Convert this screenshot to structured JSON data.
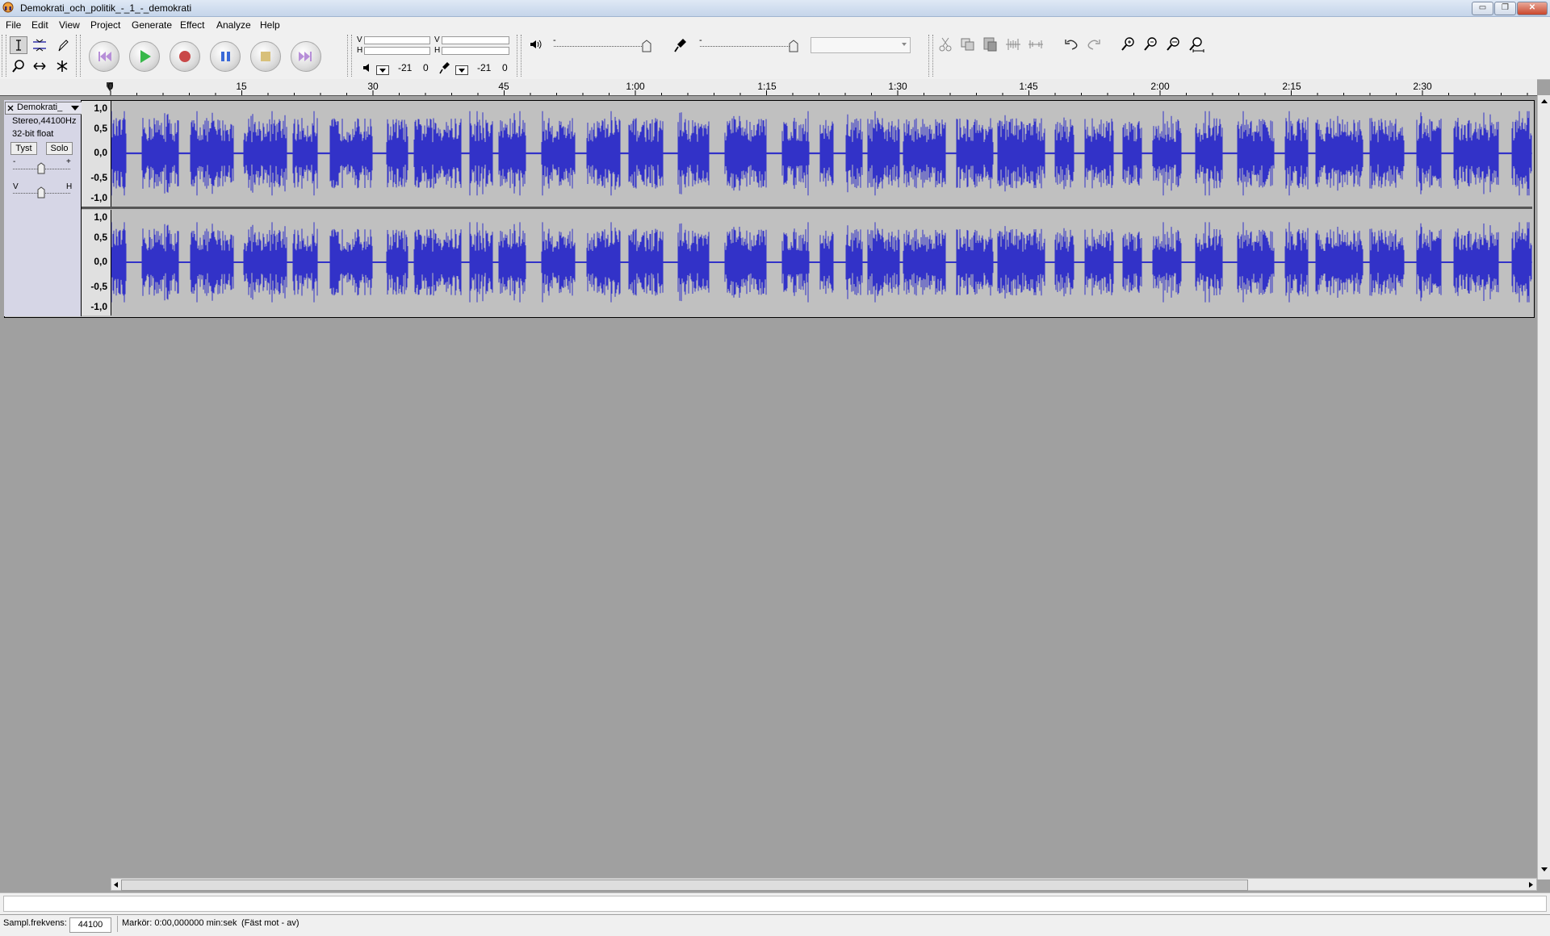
{
  "window": {
    "title": "Demokrati_och_politik_-_1_-_demokrati",
    "minimize": "▭",
    "maximize": "❐",
    "close": "✕"
  },
  "menu": [
    "File",
    "Edit",
    "View",
    "Project",
    "Generate",
    "Effect",
    "Analyze",
    "Help"
  ],
  "tools": {
    "select": "selection-tool-icon",
    "envelope": "envelope-tool-icon",
    "draw": "draw-tool-icon",
    "zoom": "zoom-tool-icon",
    "timeshift": "timeshift-tool-icon",
    "multi": "multi-tool-icon"
  },
  "transport": {
    "skip_start": "skip-start-icon",
    "play": "play-icon",
    "record": "record-icon",
    "pause": "pause-icon",
    "stop": "stop-icon",
    "skip_end": "skip-end-icon"
  },
  "meters": {
    "play": {
      "left_label": "V",
      "right_label": "H",
      "db_min": "-21",
      "db_max": "0"
    },
    "record": {
      "left_label": "V",
      "right_label": "H",
      "db_min": "-21",
      "db_max": "0"
    }
  },
  "mixer": {
    "output_minus": "-",
    "input_minus": "-",
    "input_source": ""
  },
  "ruler": {
    "ticks": [
      "0",
      "15",
      "30",
      "45",
      "1:00",
      "1:15",
      "1:30",
      "1:45",
      "2:00",
      "2:15",
      "2:30"
    ]
  },
  "track": {
    "name": "Demokrati_",
    "format": "Stereo,44100Hz",
    "bits": "32-bit float",
    "mute_label": "Tyst",
    "solo_label": "Solo",
    "gain_minus": "-",
    "gain_plus": "+",
    "pan_left": "V",
    "pan_right": "H",
    "scale": [
      "1,0",
      "0,5",
      "0,0",
      "-0,5",
      "-1,0"
    ],
    "waveform_color": "#3232c8"
  },
  "status": {
    "message": "",
    "rate_label": "Sampl.frekvens:",
    "rate_value": "44100",
    "cursor_text": "Markör: 0:00,000000 min:sek",
    "snap_text": "(Fäst mot - av)"
  }
}
